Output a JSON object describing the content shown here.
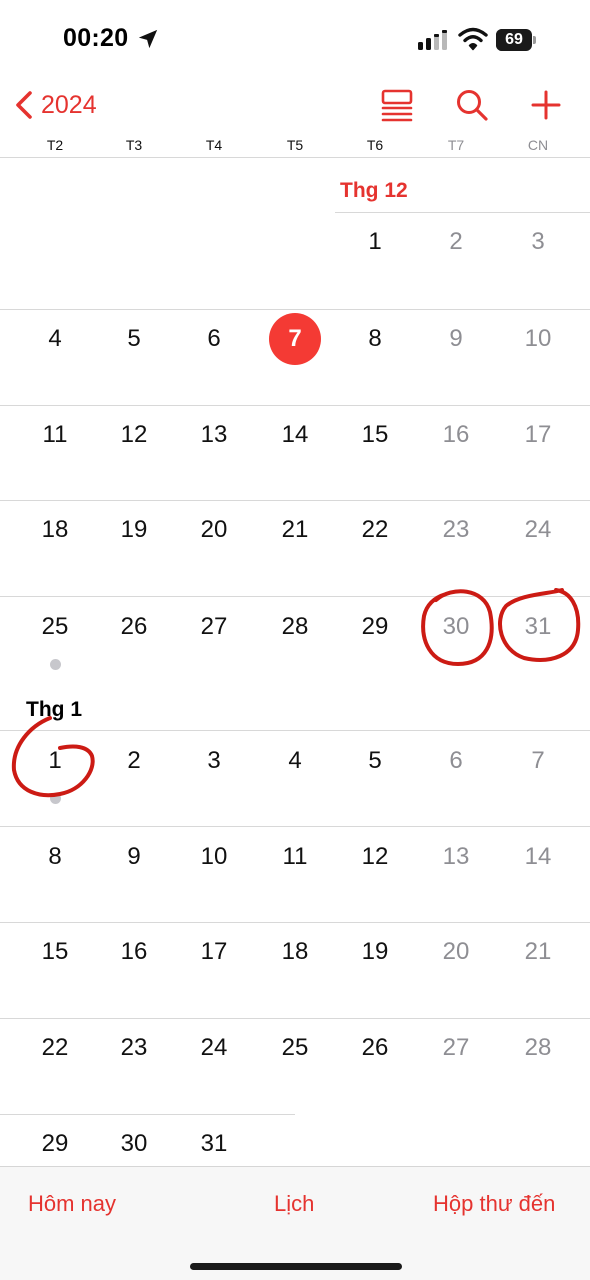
{
  "status_bar": {
    "time": "00:20",
    "battery": "69",
    "battery_level": 0.69
  },
  "nav": {
    "back_label": "2024"
  },
  "weekdays": [
    "T2",
    "T3",
    "T4",
    "T5",
    "T6",
    "T7",
    "CN"
  ],
  "months": [
    {
      "label": "Thg 12",
      "weeks": [
        [
          "",
          "",
          "",
          "",
          "1",
          "2",
          "3"
        ],
        [
          "4",
          "5",
          "6",
          "7",
          "8",
          "9",
          "10"
        ],
        [
          "11",
          "12",
          "13",
          "14",
          "15",
          "16",
          "17"
        ],
        [
          "18",
          "19",
          "20",
          "21",
          "22",
          "23",
          "24"
        ],
        [
          "25",
          "26",
          "27",
          "28",
          "29",
          "30",
          "31"
        ]
      ]
    },
    {
      "label": "Thg 1",
      "weeks": [
        [
          "1",
          "2",
          "3",
          "4",
          "5",
          "6",
          "7"
        ],
        [
          "8",
          "9",
          "10",
          "11",
          "12",
          "13",
          "14"
        ],
        [
          "15",
          "16",
          "17",
          "18",
          "19",
          "20",
          "21"
        ],
        [
          "22",
          "23",
          "24",
          "25",
          "26",
          "27",
          "28"
        ],
        [
          "29",
          "30",
          "31",
          "",
          "",
          "",
          ""
        ]
      ]
    }
  ],
  "today": "7",
  "event_days": [
    "Thg 12 25",
    "Thg 1 1"
  ],
  "tabs": {
    "today": "Hôm nay",
    "calendars": "Lịch",
    "inbox": "Hộp thư đến"
  },
  "colors": {
    "accent": "#e5332f",
    "today_circle": "#f43a34",
    "weekend_text": "#8e8e93",
    "annotation_ink": "#cc1b14"
  }
}
